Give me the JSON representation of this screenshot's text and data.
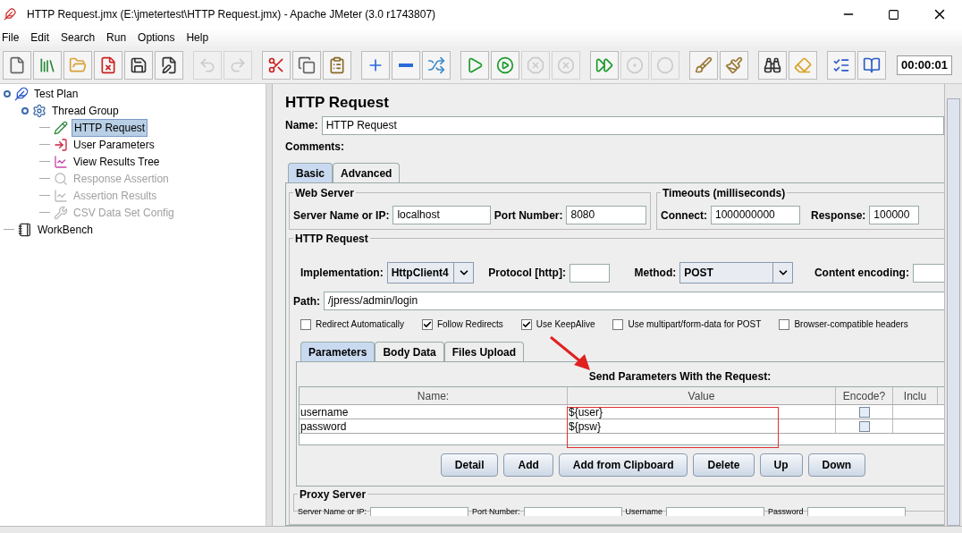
{
  "window": {
    "title": "HTTP Request.jmx (E:\\jmetertest\\HTTP Request.jmx) - Apache JMeter (3.0 r1743807)"
  },
  "menu": [
    "File",
    "Edit",
    "Search",
    "Run",
    "Options",
    "Help"
  ],
  "toolbar": [
    {
      "disabled": false
    },
    {
      "disabled": false
    },
    {
      "disabled": false
    },
    {
      "disabled": false
    },
    {
      "disabled": false
    },
    {
      "disabled": false
    },
    {
      "disabled": true
    },
    {
      "disabled": true
    },
    {
      "disabled": false
    },
    {
      "disabled": false
    },
    {
      "disabled": false
    },
    {
      "disabled": false
    },
    {
      "disabled": false
    },
    {
      "disabled": false
    },
    {
      "disabled": false
    },
    {
      "disabled": false
    },
    {
      "disabled": true
    },
    {
      "disabled": true
    },
    {
      "disabled": false
    },
    {
      "disabled": true
    },
    {
      "disabled": true
    },
    {
      "disabled": false
    },
    {
      "disabled": false
    },
    {
      "disabled": false
    },
    {
      "disabled": false
    },
    {
      "disabled": false
    },
    {
      "disabled": false
    }
  ],
  "timer": "00:00:01",
  "tree": [
    {
      "label": "Test Plan",
      "kind": "plan",
      "selected": false,
      "disabled": false,
      "children": [
        {
          "label": "Thread Group",
          "kind": "threads",
          "selected": false,
          "disabled": false,
          "children": [
            {
              "label": "HTTP Request",
              "kind": "sampler",
              "selected": true,
              "disabled": false
            },
            {
              "label": "User Parameters",
              "kind": "preprocessor",
              "selected": false,
              "disabled": false
            },
            {
              "label": "View Results Tree",
              "kind": "listener",
              "selected": false,
              "disabled": false
            },
            {
              "label": "Response Assertion",
              "kind": "assertion",
              "selected": false,
              "disabled": true
            },
            {
              "label": "Assertion Results",
              "kind": "listener",
              "selected": false,
              "disabled": true
            },
            {
              "label": "CSV Data Set Config",
              "kind": "config",
              "selected": false,
              "disabled": true
            }
          ]
        }
      ]
    },
    {
      "label": "WorkBench",
      "kind": "workbench",
      "selected": false,
      "disabled": false
    }
  ],
  "editor": {
    "title": "HTTP Request",
    "name_label": "Name:",
    "name_value": "HTTP Request",
    "comments_label": "Comments:",
    "tabs": [
      {
        "label": "Basic",
        "selected": true
      },
      {
        "label": "Advanced",
        "selected": false
      }
    ],
    "web_server": {
      "title": "Web Server",
      "server_label": "Server Name or IP:",
      "server_value": "localhost",
      "port_label": "Port Number:",
      "port_value": "8080"
    },
    "timeouts": {
      "title": "Timeouts (milliseconds)",
      "connect_label": "Connect:",
      "connect_value": "1000000000",
      "response_label": "Response:",
      "response_value": "100000"
    },
    "http_request": {
      "title": "HTTP Request",
      "implementation_label": "Implementation:",
      "implementation_value": "HttpClient4",
      "protocol_label": "Protocol [http]:",
      "method_label": "Method:",
      "method_value": "POST",
      "encoding_label": "Content encoding:",
      "path_label": "Path:",
      "path_value": "/jpress/admin/login",
      "options": [
        {
          "label": "Redirect Automatically",
          "checked": false
        },
        {
          "label": "Follow Redirects",
          "checked": true
        },
        {
          "label": "Use KeepAlive",
          "checked": true
        },
        {
          "label": "Use multipart/form-data for POST",
          "checked": false
        },
        {
          "label": "Browser-compatible headers",
          "checked": false
        }
      ]
    },
    "param_tabs": [
      {
        "label": "Parameters",
        "selected": true
      },
      {
        "label": "Body Data",
        "selected": false
      },
      {
        "label": "Files Upload",
        "selected": false
      }
    ],
    "params": {
      "title": "Send Parameters With the Request:",
      "columns": [
        "Name:",
        "Value",
        "Encode?",
        "Inclu"
      ],
      "rows": [
        {
          "name": "username",
          "value": "${user}",
          "encode": false
        },
        {
          "name": "password",
          "value": "${psw}",
          "encode": false
        }
      ]
    },
    "buttons": [
      "Detail",
      "Add",
      "Add from Clipboard",
      "Delete",
      "Up",
      "Down"
    ],
    "proxy": {
      "title": "Proxy Server",
      "fields": [
        "Server Name or IP:",
        "Port Number:",
        "Username",
        "Password"
      ]
    }
  }
}
